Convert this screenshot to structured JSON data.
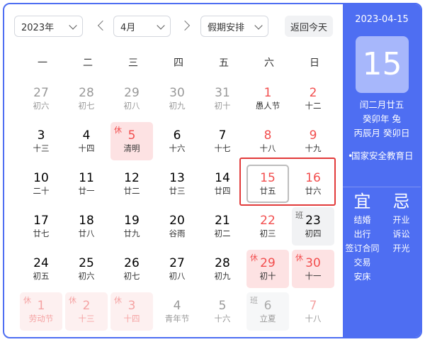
{
  "toolbar": {
    "year": "2023年",
    "month": "4月",
    "holiday_select": "假期安排",
    "today_button": "返回今天"
  },
  "weekdays": [
    "一",
    "二",
    "三",
    "四",
    "五",
    "六",
    "日"
  ],
  "days": [
    {
      "num": "27",
      "lunar": "初六",
      "other": true
    },
    {
      "num": "28",
      "lunar": "初七",
      "other": true
    },
    {
      "num": "29",
      "lunar": "初八",
      "other": true
    },
    {
      "num": "30",
      "lunar": "初九",
      "other": true
    },
    {
      "num": "31",
      "lunar": "初十",
      "other": true
    },
    {
      "num": "1",
      "lunar": "愚人节",
      "weekend": true
    },
    {
      "num": "2",
      "lunar": "十二",
      "weekend": true
    },
    {
      "num": "3",
      "lunar": "十三"
    },
    {
      "num": "4",
      "lunar": "十四"
    },
    {
      "num": "5",
      "lunar": "清明",
      "badge": "休",
      "type": "rest"
    },
    {
      "num": "6",
      "lunar": "十六"
    },
    {
      "num": "7",
      "lunar": "十七"
    },
    {
      "num": "8",
      "lunar": "十八",
      "weekend": true
    },
    {
      "num": "9",
      "lunar": "十九",
      "weekend": true
    },
    {
      "num": "10",
      "lunar": "二十"
    },
    {
      "num": "11",
      "lunar": "廿一"
    },
    {
      "num": "12",
      "lunar": "廿二"
    },
    {
      "num": "13",
      "lunar": "廿三"
    },
    {
      "num": "14",
      "lunar": "廿四"
    },
    {
      "num": "15",
      "lunar": "廿五",
      "weekend": true,
      "selected": true
    },
    {
      "num": "16",
      "lunar": "廿六",
      "weekend": true
    },
    {
      "num": "17",
      "lunar": "廿七"
    },
    {
      "num": "18",
      "lunar": "廿八"
    },
    {
      "num": "19",
      "lunar": "廿九"
    },
    {
      "num": "20",
      "lunar": "谷雨"
    },
    {
      "num": "21",
      "lunar": "初二"
    },
    {
      "num": "22",
      "lunar": "初三",
      "weekend": true
    },
    {
      "num": "23",
      "lunar": "初四",
      "badge": "班",
      "type": "work"
    },
    {
      "num": "24",
      "lunar": "初五"
    },
    {
      "num": "25",
      "lunar": "初六"
    },
    {
      "num": "26",
      "lunar": "初七"
    },
    {
      "num": "27",
      "lunar": "初八"
    },
    {
      "num": "28",
      "lunar": "初九"
    },
    {
      "num": "29",
      "lunar": "初十",
      "badge": "休",
      "type": "rest"
    },
    {
      "num": "30",
      "lunar": "十一",
      "badge": "休",
      "type": "rest"
    },
    {
      "num": "1",
      "lunar": "劳动节",
      "badge": "休",
      "type": "rest",
      "other": true
    },
    {
      "num": "2",
      "lunar": "十三",
      "badge": "休",
      "type": "rest",
      "other": true
    },
    {
      "num": "3",
      "lunar": "十四",
      "badge": "休",
      "type": "rest",
      "other": true
    },
    {
      "num": "4",
      "lunar": "青年节",
      "other": true
    },
    {
      "num": "5",
      "lunar": "十六",
      "other": true
    },
    {
      "num": "6",
      "lunar": "立夏",
      "badge": "班",
      "type": "work",
      "other": true
    },
    {
      "num": "7",
      "lunar": "十八",
      "weekend": true,
      "other": true
    }
  ],
  "side": {
    "date": "2023-04-15",
    "day": "15",
    "lunar_date": "闰二月廿五",
    "year_ganzhi": "癸卯年 兔",
    "month_day_ganzhi": "丙辰月 癸卯日",
    "festival": "国家安全教育日",
    "yi_title": "宜",
    "ji_title": "忌",
    "yi": [
      "结婚",
      "出行",
      "签订合同",
      "交易",
      "安床"
    ],
    "ji": [
      "开业",
      "诉讼",
      "开光"
    ]
  },
  "colors": {
    "accent": "#4e6ef2",
    "holiday_red": "#f24e4e",
    "rest_bg": "#fde2e3",
    "work_bg": "#f1f2f4"
  }
}
